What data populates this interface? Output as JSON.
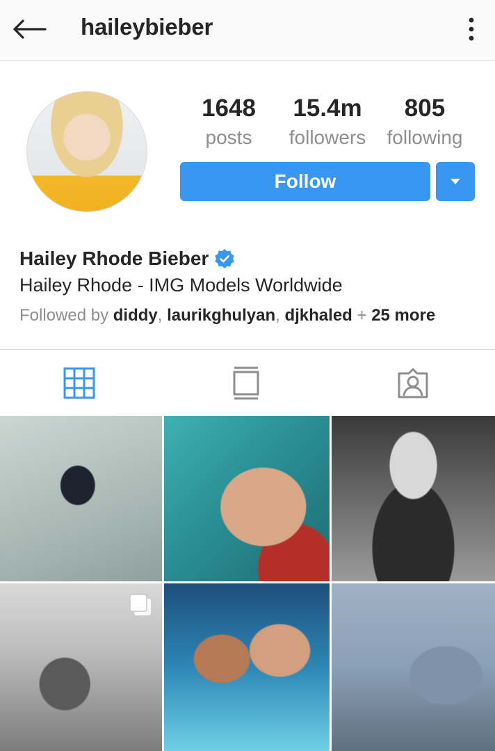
{
  "header": {
    "username": "haileybieber",
    "back_icon": "arrow-left-icon",
    "more_icon": "more-vertical-icon"
  },
  "profile": {
    "stats": {
      "posts_count": "1648",
      "posts_label": "posts",
      "followers_count": "15.4m",
      "followers_label": "followers",
      "following_count": "805",
      "following_label": "following"
    },
    "follow_label": "Follow",
    "dropdown_icon": "caret-down-icon",
    "full_name": "Hailey Rhode Bieber",
    "verified_icon": "verified-badge-icon",
    "bio": "Hailey Rhode - IMG Models Worldwide",
    "followed_by": {
      "prefix": "Followed by",
      "users": [
        "diddy",
        "laurikghulyan",
        "djkhaled"
      ],
      "plus": "+",
      "more": "25 more"
    }
  },
  "tabs": [
    {
      "name": "grid",
      "icon": "grid-icon",
      "active": true
    },
    {
      "name": "feed",
      "icon": "feed-icon",
      "active": false
    },
    {
      "name": "tagged",
      "icon": "tagged-person-icon",
      "active": false
    }
  ],
  "colors": {
    "accent": "#3897f0",
    "text": "#262626",
    "secondary_text": "#8e8e8e",
    "border": "#dbdbdb",
    "header_bg": "#fafafa"
  },
  "posts": [
    {
      "type": "photo"
    },
    {
      "type": "photo"
    },
    {
      "type": "photo"
    },
    {
      "type": "carousel",
      "icon": "multiple-photos-icon"
    },
    {
      "type": "photo"
    },
    {
      "type": "photo"
    }
  ]
}
